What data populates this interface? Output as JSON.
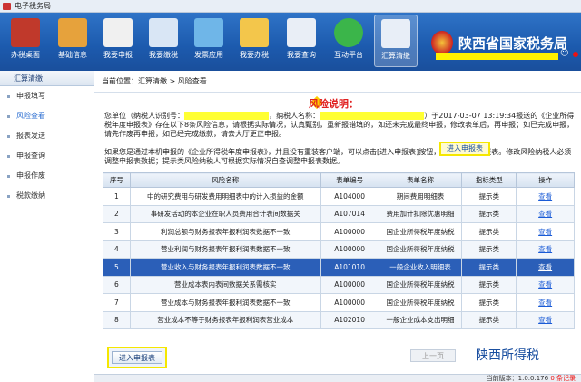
{
  "window": {
    "title": "电子税务局"
  },
  "toolbar": {
    "items": [
      {
        "label": "办税桌面",
        "color": "#c0392b"
      },
      {
        "label": "基础信息",
        "color": "#e6a23c"
      },
      {
        "label": "我要申报",
        "color": "#f0f0f0"
      },
      {
        "label": "我要缴税",
        "color": "#d9e6f5"
      },
      {
        "label": "发票应用",
        "color": "#6fb6e8"
      },
      {
        "label": "我要办税",
        "color": "#f3c64b"
      },
      {
        "label": "我要查询",
        "color": "#e9eef6"
      },
      {
        "label": "互动平台",
        "color": "#3bb54a"
      },
      {
        "label": "汇算清缴",
        "color": "#e8eef7"
      }
    ],
    "brand": "陕西省国家税务局",
    "user_icon": "user-icon"
  },
  "sidebar": {
    "header": "汇算清缴",
    "items": [
      {
        "label": "申报填写"
      },
      {
        "label": "风险查看"
      },
      {
        "label": "报表发送"
      },
      {
        "label": "申报查询"
      },
      {
        "label": "申报作废"
      },
      {
        "label": "税款缴纳"
      }
    ]
  },
  "breadcrumb": {
    "prefix": "当前位置：",
    "parts": "汇算清缴 > 风险查看"
  },
  "notice": {
    "title": "风险说明：",
    "para1_a": "您单位（纳税人识别号：",
    "para1_b": "，纳税人名称：",
    "para1_c": "）于2017-03-07 13:19:34报送的《企业所得税年度申报表》存在以下8条风险信息，请根据实际情况，认真甄别，重新报错填的，如还未完成最终申报，修改表单后，再申报；如已完成申报，请先作废再申报，如已经完成缴款，请去大厅更正申报。",
    "para2": "如果您是通过本机申报的《企业所得税年度申报表》，并且没有重装客户端，可以点击[进入申报表]按钮，查询并修改申报表。修改风险纳税人必须调整申报表数据；提示类风险纳税人可根据实际情况自查调整申报表数据。",
    "enter_label": "进入申报表"
  },
  "table": {
    "headers": [
      "序号",
      "风险名称",
      "表单编号",
      "表单名称",
      "指标类型",
      "操作"
    ],
    "rows": [
      {
        "no": "1",
        "name": "中的研究费用与研发费用明细表中的计入损益的金额",
        "code": "A104000",
        "form": "期间费用明细表",
        "type": "提示类",
        "op": "查看"
      },
      {
        "no": "2",
        "name": "事研发活动的本企业在职人员费用合计表间数据关",
        "code": "A107014",
        "form": "费用加计扣除优惠明细",
        "type": "提示类",
        "op": "查看"
      },
      {
        "no": "3",
        "name": "利润总额与财务报表年报利润表数据不一致",
        "code": "A100000",
        "form": "国企业所得税年度纳税",
        "type": "提示类",
        "op": "查看"
      },
      {
        "no": "4",
        "name": "营业利润与财务报表年报利润表数据不一致",
        "code": "A100000",
        "form": "国企业所得税年度纳税",
        "type": "提示类",
        "op": "查看"
      },
      {
        "no": "5",
        "name": "营业收入与财务报表年报利润表数据不一致",
        "code": "A101010",
        "form": "一般企业收入明细表",
        "type": "提示类",
        "op": "查看"
      },
      {
        "no": "6",
        "name": "营业成本表内表间数据关系需核实",
        "code": "A100000",
        "form": "国企业所得税年度纳税",
        "type": "提示类",
        "op": "查看"
      },
      {
        "no": "7",
        "name": "营业成本与财务报表年报利润表数据不一致",
        "code": "A100000",
        "form": "国企业所得税年度纳税",
        "type": "提示类",
        "op": "查看"
      },
      {
        "no": "8",
        "name": "营业成本不等于财务报表年报利润表营业成本",
        "code": "A102010",
        "form": "一般企业成本支出明细",
        "type": "提示类",
        "op": "查看"
      }
    ],
    "selected_row": 5
  },
  "buttons": {
    "enter_label": "进入申报表",
    "prev_label": "上一页"
  },
  "statusbar": {
    "version": "当前版本：1.0.0.176",
    "extra": "0 条记录"
  },
  "watermark": "陕西所得税"
}
